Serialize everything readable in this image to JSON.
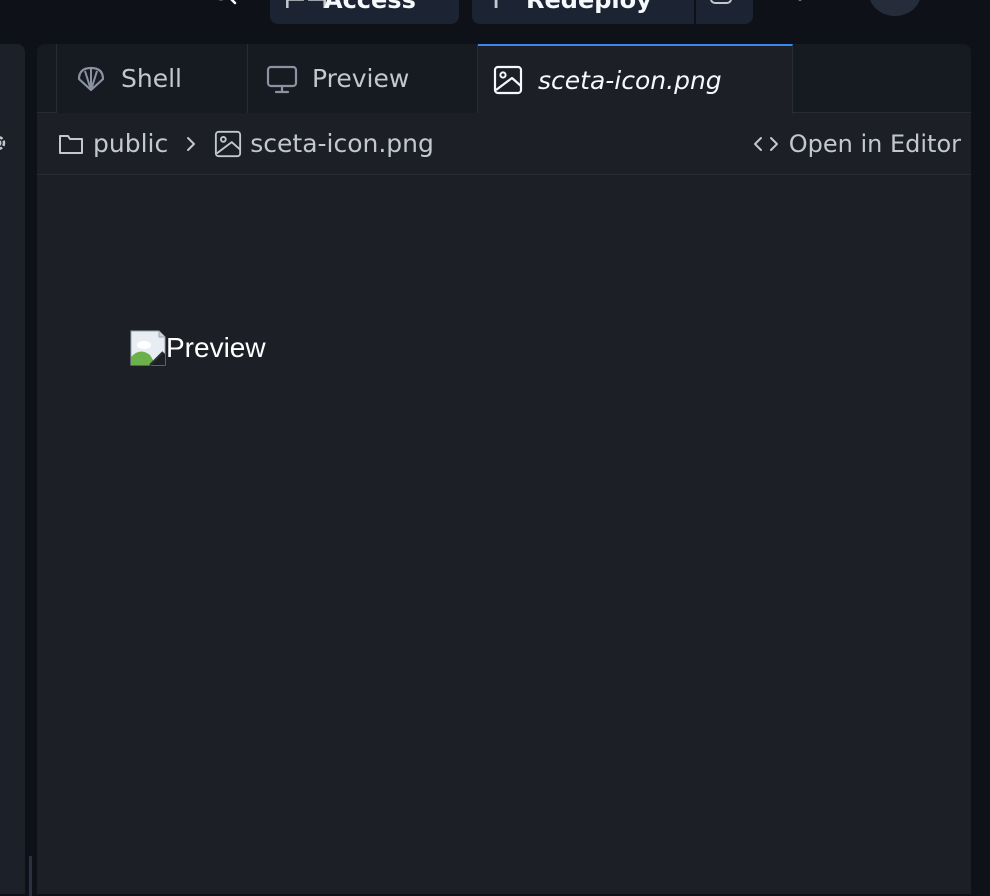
{
  "topbar": {
    "access_label": "Access",
    "redeploy_label": "Redeploy"
  },
  "tabs": [
    {
      "label": "Shell",
      "icon": "shell-icon",
      "active": false
    },
    {
      "label": "Preview",
      "icon": "monitor-icon",
      "active": false
    },
    {
      "label": "sceta-icon.png",
      "icon": "image-icon",
      "active": true
    }
  ],
  "breadcrumb": {
    "folder": "public",
    "file": "sceta-icon.png"
  },
  "open_in_editor_label": "Open in Editor",
  "viewer": {
    "image_alt": "Preview"
  },
  "colors": {
    "background": "#0e1117",
    "pane": "#1c1f26",
    "active_tab_accent": "#3a85f0",
    "text": "#f5f9fc",
    "muted_text": "#c2c8cc"
  }
}
